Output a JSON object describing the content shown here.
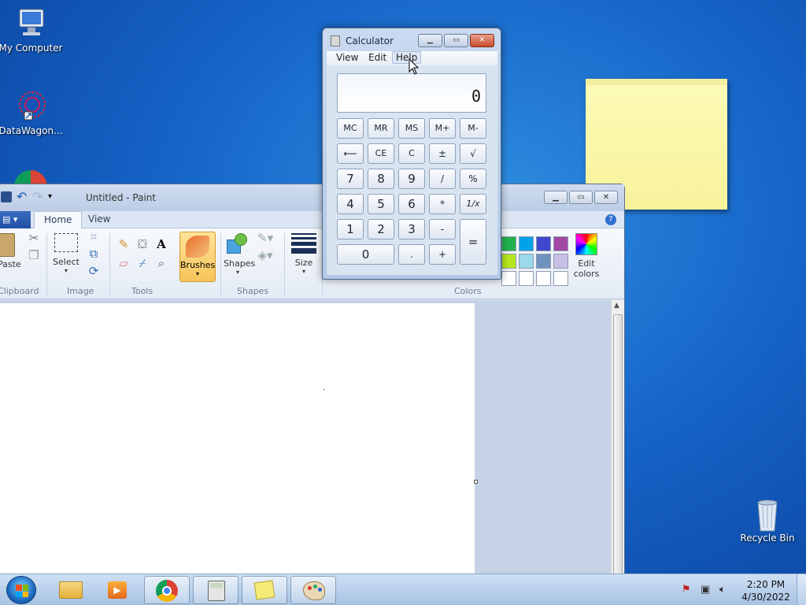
{
  "desktop": {
    "icons": [
      {
        "label": "My Computer",
        "icon": "computer-icon"
      },
      {
        "label": "DataWagon...",
        "icon": "datawagon-icon"
      },
      {
        "label": "Recycle Bin",
        "icon": "recycle-bin-icon"
      }
    ]
  },
  "paint": {
    "title": "Untitled - Paint",
    "tabs": [
      "Home",
      "View"
    ],
    "groups": [
      "Clipboard",
      "Image",
      "Tools",
      "Shapes",
      "Colors"
    ],
    "buttons": {
      "paste": "Paste",
      "select": "Select",
      "brushes": "Brushes",
      "shapes": "Shapes",
      "size": "Size",
      "edit_colors": "Edit colors"
    },
    "palette": [
      "#22b14c",
      "#00a2e8",
      "#3f48cc",
      "#a349a4",
      "#b5e61d",
      "#99d9ea",
      "#7092be",
      "#c8bfe7",
      "#ffffff",
      "#ffffff",
      "#ffffff",
      "#ffffff"
    ]
  },
  "calculator": {
    "title": "Calculator",
    "menu": [
      "View",
      "Edit",
      "Help"
    ],
    "display": "0",
    "keys": {
      "memory": [
        "MC",
        "MR",
        "MS",
        "M+",
        "M-"
      ],
      "row2": [
        "⟵",
        "CE",
        "C",
        "±",
        "√"
      ],
      "row3": [
        "7",
        "8",
        "9",
        "/",
        "%"
      ],
      "row4": [
        "4",
        "5",
        "6",
        "*",
        "1/x"
      ],
      "row5": [
        "1",
        "2",
        "3",
        "-",
        "="
      ],
      "row6": [
        "0",
        ".",
        "+"
      ]
    }
  },
  "taskbar": {
    "time": "2:20 PM",
    "date": "4/30/2022"
  }
}
